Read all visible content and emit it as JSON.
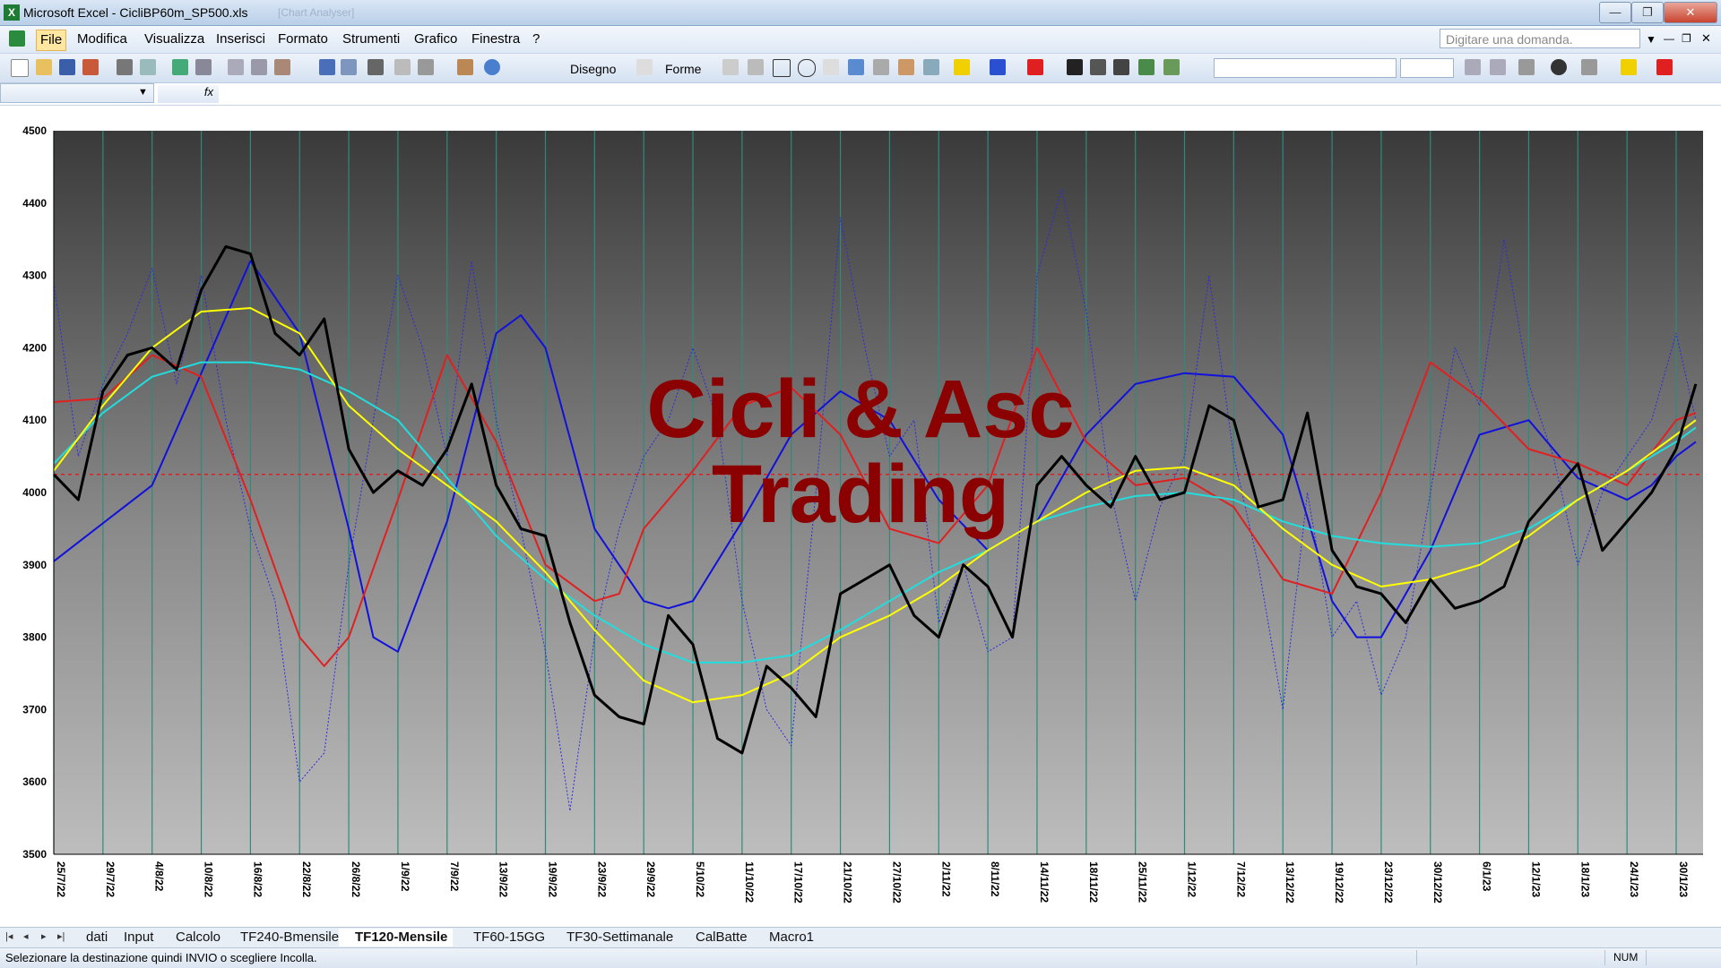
{
  "window": {
    "title": "Microsoft Excel - CicliBP60m_SP500.xls",
    "ghost_title": "[Chart Analyser]",
    "app_icon": "excel-icon",
    "controls": [
      "minimize-icon",
      "restore-icon",
      "close-icon"
    ]
  },
  "menu": {
    "items": [
      "File",
      "Modifica",
      "Visualizza",
      "Inserisci",
      "Formato",
      "Strumenti",
      "Grafico",
      "Finestra",
      "?"
    ],
    "active": "File",
    "ask_placeholder": "Digitare una domanda."
  },
  "toolbar": {
    "disegno_label": "Disegno",
    "forme_label": "Forme",
    "icons": [
      "new-icon",
      "open-icon",
      "save-icon",
      "permission-icon",
      "print-icon",
      "print-preview-icon",
      "spelling-icon",
      "research-icon",
      "cut-icon",
      "copy-icon",
      "paste-icon",
      "undo-icon",
      "redo-icon",
      "hyperlink-icon",
      "autosum-icon",
      "sort-icon",
      "chart-wizard-icon",
      "help-icon",
      "select-pointer-icon",
      "line-icon",
      "arrow-icon",
      "rectangle-icon",
      "oval-icon",
      "textbox-icon",
      "wordart-icon",
      "diagram-icon",
      "clipart-icon",
      "picture-icon",
      "fill-color-icon",
      "line-color-icon",
      "font-color-icon",
      "line-style-icon",
      "dash-style-icon",
      "arrow-style-icon",
      "shadow-icon",
      "3d-icon",
      "bold-icon",
      "italic-icon",
      "align-icon",
      "euro-icon",
      "borders-icon",
      "highlight-icon",
      "font-color-icon-2"
    ]
  },
  "formula": {
    "name_box": "",
    "fx_label": "fx"
  },
  "chart_data": {
    "type": "line",
    "watermark": [
      "Cicli & Asc",
      "Trading"
    ],
    "ylim": [
      3500,
      4500
    ],
    "y_ticks": [
      "4500",
      "4400",
      "4300",
      "4200",
      "4100",
      "4000",
      "3900",
      "3800",
      "3700",
      "3600",
      "3500"
    ],
    "x_ticks": [
      "25/7/22",
      "29/7/22",
      "4/8/22",
      "10/8/22",
      "16/8/22",
      "22/8/22",
      "26/8/22",
      "1/9/22",
      "7/9/22",
      "13/9/22",
      "19/9/22",
      "23/9/22",
      "29/9/22",
      "5/10/22",
      "11/10/22",
      "17/10/22",
      "21/10/22",
      "27/10/22",
      "2/11/22",
      "8/11/22",
      "14/11/22",
      "18/11/22",
      "25/11/22",
      "1/12/22",
      "7/12/22",
      "13/12/22",
      "19/12/22",
      "23/12/22",
      "30/12/22",
      "6/1/23",
      "12/1/23",
      "18/1/23",
      "24/1/23",
      "30/1/23"
    ],
    "reference_line": 4025,
    "grid": true,
    "colors": {
      "price": "#000000",
      "dotted": "#2a2ae0",
      "blue": "#1111dd",
      "red": "#e02020",
      "yellow": "#ffff00",
      "cyan": "#22dddd",
      "reference": "#e02020",
      "vgrid": "#2e8b7a",
      "watermark": "#8b0000"
    },
    "series": [
      {
        "key": "price",
        "x": [
          0,
          0.5,
          1,
          1.5,
          2,
          2.5,
          3,
          3.5,
          4,
          4.5,
          5,
          5.5,
          6,
          6.5,
          7,
          7.5,
          8,
          8.5,
          9,
          9.5,
          10,
          10.5,
          11,
          11.5,
          12,
          12.5,
          13,
          13.5,
          14,
          14.5,
          15,
          15.5,
          16,
          16.5,
          17,
          17.5,
          18,
          18.5,
          19,
          19.5,
          20,
          20.5,
          21,
          21.5,
          22,
          22.5,
          23,
          23.5,
          24,
          24.5,
          25,
          25.5,
          26,
          26.5,
          27,
          27.5,
          28,
          28.5,
          29,
          29.5,
          30,
          30.5,
          31,
          31.5,
          32,
          32.5,
          33,
          33.4
        ],
        "values": [
          4025,
          3990,
          4140,
          4190,
          4200,
          4170,
          4280,
          4340,
          4330,
          4220,
          4190,
          4240,
          4060,
          4000,
          4030,
          4010,
          4060,
          4150,
          4010,
          3950,
          3940,
          3820,
          3720,
          3690,
          3680,
          3830,
          3790,
          3660,
          3640,
          3760,
          3730,
          3690,
          3860,
          3880,
          3900,
          3830,
          3800,
          3900,
          3870,
          3800,
          4010,
          4050,
          4010,
          3980,
          4050,
          3990,
          4000,
          4120,
          4100,
          3980,
          3990,
          4110,
          3920,
          3870,
          3860,
          3820,
          3880,
          3840,
          3850,
          3870,
          3960,
          4000,
          4040,
          3920,
          3960,
          4000,
          4060,
          4150
        ]
      },
      {
        "key": "dotted",
        "x": [
          0,
          0.5,
          1,
          1.5,
          2,
          2.5,
          3,
          3.5,
          4,
          4.5,
          5,
          5.5,
          6,
          6.5,
          7,
          7.5,
          8,
          8.5,
          9,
          9.5,
          10,
          10.5,
          11,
          11.5,
          12,
          12.5,
          13,
          13.5,
          14,
          14.5,
          15,
          15.5,
          16,
          16.5,
          17,
          17.5,
          18,
          18.5,
          19,
          19.5,
          20,
          20.5,
          21,
          21.5,
          22,
          22.5,
          23,
          23.5,
          24,
          24.5,
          25,
          25.5,
          26,
          26.5,
          27,
          27.5,
          28,
          28.5,
          29,
          29.5,
          30,
          30.5,
          31,
          31.5,
          32,
          32.5,
          33,
          33.4
        ],
        "values": [
          4290,
          4050,
          4150,
          4220,
          4310,
          4150,
          4300,
          4100,
          3950,
          3850,
          3600,
          3640,
          3900,
          4100,
          4300,
          4200,
          4050,
          4320,
          4100,
          3950,
          3780,
          3560,
          3800,
          3950,
          4050,
          4100,
          4200,
          4100,
          3850,
          3700,
          3650,
          4000,
          4380,
          4200,
          4050,
          4100,
          3820,
          3900,
          3780,
          3800,
          4300,
          4420,
          4250,
          4000,
          3850,
          3980,
          4050,
          4300,
          4050,
          3900,
          3700,
          4000,
          3800,
          3850,
          3720,
          3800,
          4000,
          4200,
          4120,
          4350,
          4150,
          4050,
          3900,
          4000,
          4050,
          4100,
          4220,
          4100
        ]
      },
      {
        "key": "blue",
        "x": [
          0,
          2,
          4,
          5,
          6,
          6.5,
          7,
          8,
          9,
          9.5,
          10,
          11,
          12,
          12.5,
          13,
          14,
          15,
          16,
          17,
          18,
          19,
          20,
          21,
          22,
          23,
          24,
          25,
          26,
          26.5,
          27,
          28,
          29,
          30,
          31,
          32,
          32.5,
          33,
          33.4
        ],
        "values": [
          3905,
          4010,
          4320,
          4220,
          3950,
          3800,
          3780,
          3960,
          4220,
          4245,
          4200,
          3950,
          3850,
          3840,
          3850,
          3960,
          4080,
          4140,
          4100,
          3990,
          3920,
          3960,
          4080,
          4150,
          4165,
          4160,
          4080,
          3850,
          3800,
          3800,
          3920,
          4080,
          4100,
          4020,
          3990,
          4010,
          4050,
          4070
        ]
      },
      {
        "key": "red",
        "x": [
          0,
          1,
          2,
          3,
          4,
          5,
          5.5,
          6,
          7,
          8,
          9,
          10,
          11,
          11.5,
          12,
          13,
          14,
          15,
          16,
          17,
          18,
          19,
          20,
          21,
          22,
          23,
          24,
          25,
          26,
          27,
          28,
          29,
          30,
          31,
          32,
          33,
          33.4
        ],
        "values": [
          4125,
          4130,
          4190,
          4160,
          3990,
          3800,
          3760,
          3800,
          3990,
          4190,
          4070,
          3900,
          3850,
          3860,
          3950,
          4030,
          4120,
          4145,
          4080,
          3950,
          3930,
          4010,
          4200,
          4070,
          4010,
          4020,
          3980,
          3880,
          3860,
          4000,
          4180,
          4130,
          4060,
          4040,
          4010,
          4100,
          4110
        ]
      },
      {
        "key": "yellow",
        "x": [
          0,
          1,
          2,
          3,
          4,
          5,
          6,
          7,
          8,
          9,
          10,
          11,
          12,
          13,
          14,
          15,
          16,
          17,
          18,
          19,
          20,
          21,
          22,
          23,
          24,
          25,
          26,
          27,
          28,
          29,
          30,
          31,
          32,
          33,
          33.4
        ],
        "values": [
          4030,
          4120,
          4200,
          4250,
          4255,
          4220,
          4120,
          4060,
          4010,
          3960,
          3890,
          3810,
          3740,
          3710,
          3720,
          3750,
          3800,
          3830,
          3870,
          3920,
          3960,
          4000,
          4030,
          4035,
          4010,
          3950,
          3900,
          3870,
          3880,
          3900,
          3940,
          3990,
          4030,
          4080,
          4100
        ]
      },
      {
        "key": "cyan",
        "x": [
          0,
          1,
          2,
          3,
          4,
          5,
          6,
          7,
          8,
          9,
          10,
          11,
          12,
          13,
          14,
          15,
          16,
          17,
          18,
          19,
          20,
          21,
          22,
          23,
          24,
          25,
          26,
          27,
          28,
          29,
          30,
          31,
          32,
          33,
          33.4
        ],
        "values": [
          4040,
          4110,
          4160,
          4180,
          4180,
          4170,
          4140,
          4100,
          4020,
          3940,
          3880,
          3830,
          3790,
          3765,
          3765,
          3775,
          3810,
          3850,
          3890,
          3920,
          3960,
          3980,
          3995,
          4000,
          3990,
          3960,
          3940,
          3930,
          3925,
          3930,
          3950,
          3990,
          4030,
          4070,
          4090
        ]
      }
    ]
  },
  "sheets": {
    "nav": [
      "|◂",
      "◂",
      "▸",
      "▸|"
    ],
    "tabs": [
      "dati",
      "Input",
      "Calcolo",
      "TF240-Bmensile",
      "TF120-Mensile",
      "TF60-15GG",
      "TF30-Settimanale",
      "CalBatte",
      "Macro1"
    ],
    "active": "TF120-Mensile"
  },
  "status": {
    "message": "Selezionare la destinazione quindi INVIO o scegliere Incolla.",
    "num": "NUM"
  }
}
